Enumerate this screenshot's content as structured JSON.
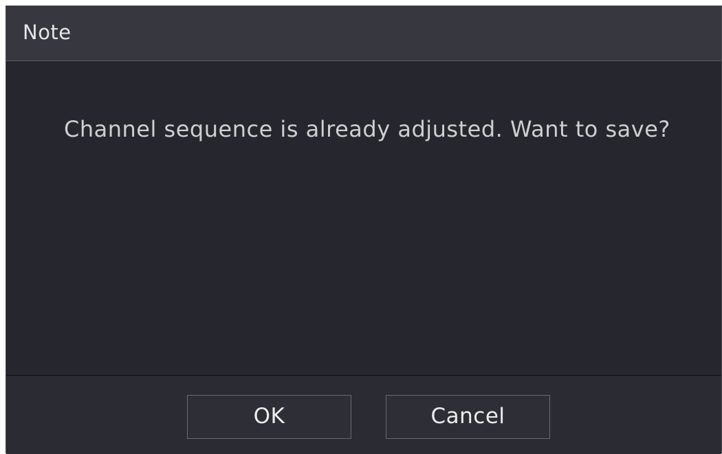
{
  "dialog": {
    "title": "Note",
    "message": "Channel sequence is already adjusted. Want to save?",
    "buttons": {
      "ok": "OK",
      "cancel": "Cancel"
    }
  },
  "colors": {
    "dialog_bg": "#26262e",
    "titlebar_bg": "#373740",
    "footer_bg": "#2b2b33",
    "text": "#e6e6e6",
    "button_border": "#6a6a72"
  }
}
